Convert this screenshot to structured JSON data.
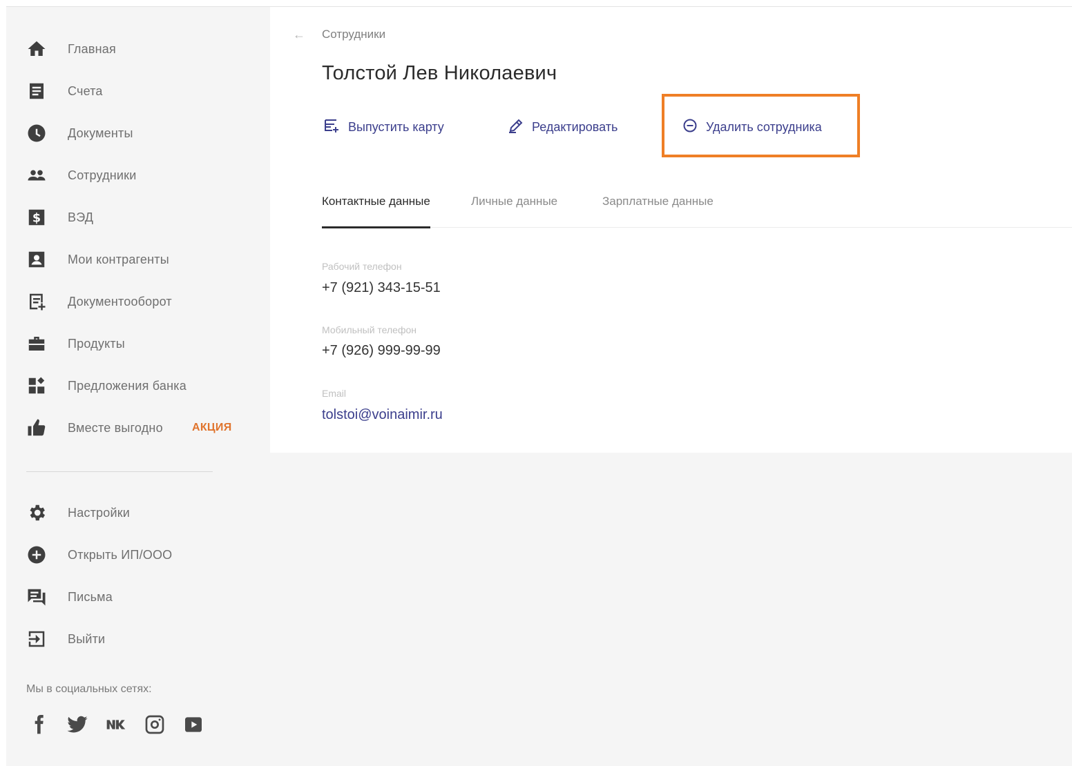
{
  "sidebar": {
    "items": [
      {
        "label": "Главная",
        "icon": "home-icon"
      },
      {
        "label": "Счета",
        "icon": "document-icon"
      },
      {
        "label": "Документы",
        "icon": "clock-icon"
      },
      {
        "label": "Сотрудники",
        "icon": "people-icon"
      },
      {
        "label": "ВЭД",
        "icon": "dollar-icon"
      },
      {
        "label": "Мои контрагенты",
        "icon": "contact-icon"
      },
      {
        "label": "Документооборот",
        "icon": "doc-flow-icon"
      },
      {
        "label": "Продукты",
        "icon": "briefcase-icon"
      },
      {
        "label": "Предложения банка",
        "icon": "offers-icon"
      },
      {
        "label": "Вместе выгодно",
        "icon": "thumbs-up-icon",
        "badge": "АКЦИЯ"
      }
    ],
    "secondary_items": [
      {
        "label": "Настройки",
        "icon": "gear-icon"
      },
      {
        "label": "Открыть ИП/ООО",
        "icon": "plus-circle-icon"
      },
      {
        "label": "Письма",
        "icon": "messages-icon"
      },
      {
        "label": "Выйти",
        "icon": "logout-icon"
      }
    ],
    "social_caption": "Мы в социальных сетях:",
    "social_icons": [
      "facebook-icon",
      "twitter-icon",
      "vk-icon",
      "instagram-icon",
      "youtube-icon"
    ]
  },
  "main": {
    "breadcrumb": "Сотрудники",
    "title": "Толстой Лев Николаевич",
    "actions": {
      "issue_card": "Выпустить карту",
      "edit": "Редактировать",
      "delete": "Удалить сотрудника"
    },
    "tabs": [
      "Контактные данные",
      "Личные данные",
      "Зарплатные данные"
    ],
    "active_tab": "Контактные данные",
    "fields": {
      "work_phone_label": "Рабочий телефон",
      "work_phone": "+7 (921) 343-15-51",
      "mobile_phone_label": "Мобильный телефон",
      "mobile_phone": "+7 (926) 999-99-99",
      "email_label": "Email",
      "email": "tolstoi@voinaimir.ru"
    }
  },
  "colors": {
    "accent": "#3b3e8c",
    "highlight": "#ef7f26",
    "promo": "#e0742d"
  }
}
